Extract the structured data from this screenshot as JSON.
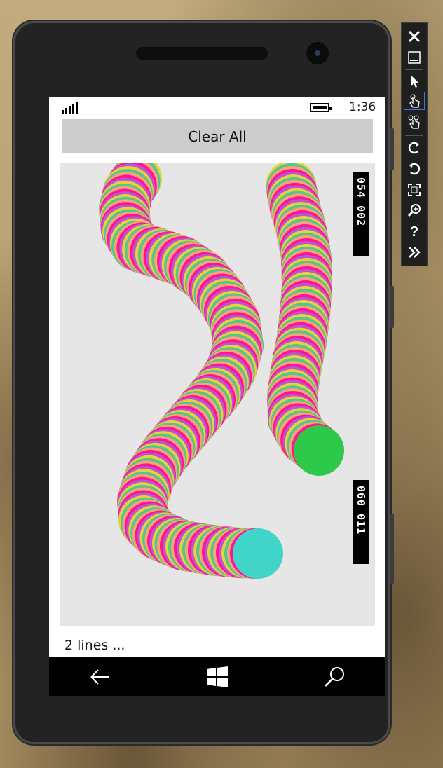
{
  "status_bar": {
    "time": "1:36"
  },
  "actions": {
    "clear_label": "Clear All"
  },
  "status": {
    "text": "2 lines ..."
  },
  "frame_counters": {
    "top": "054 002",
    "bottom": "060 011"
  },
  "strokes": [
    {
      "name": "stroke-left"
    },
    {
      "name": "stroke-right"
    }
  ],
  "navbar": {
    "back_icon": "back-arrow-icon",
    "windows_icon": "windows-logo-icon",
    "search_icon": "search-icon"
  },
  "toolbar": {
    "items": [
      "close-icon",
      "minimize-icon",
      "pointer-icon",
      "single-touch-icon",
      "pinch-zoom-icon",
      "rotate-left-icon",
      "rotate-right-icon",
      "fit-screen-icon",
      "zoom-icon",
      "help-icon",
      "more-icon"
    ]
  },
  "colors": {
    "canvas_bg": "#e6e6e6",
    "button_bg": "#cccccc",
    "last_circle_left": "#40d5c8",
    "last_circle_right": "#2ec84a"
  }
}
